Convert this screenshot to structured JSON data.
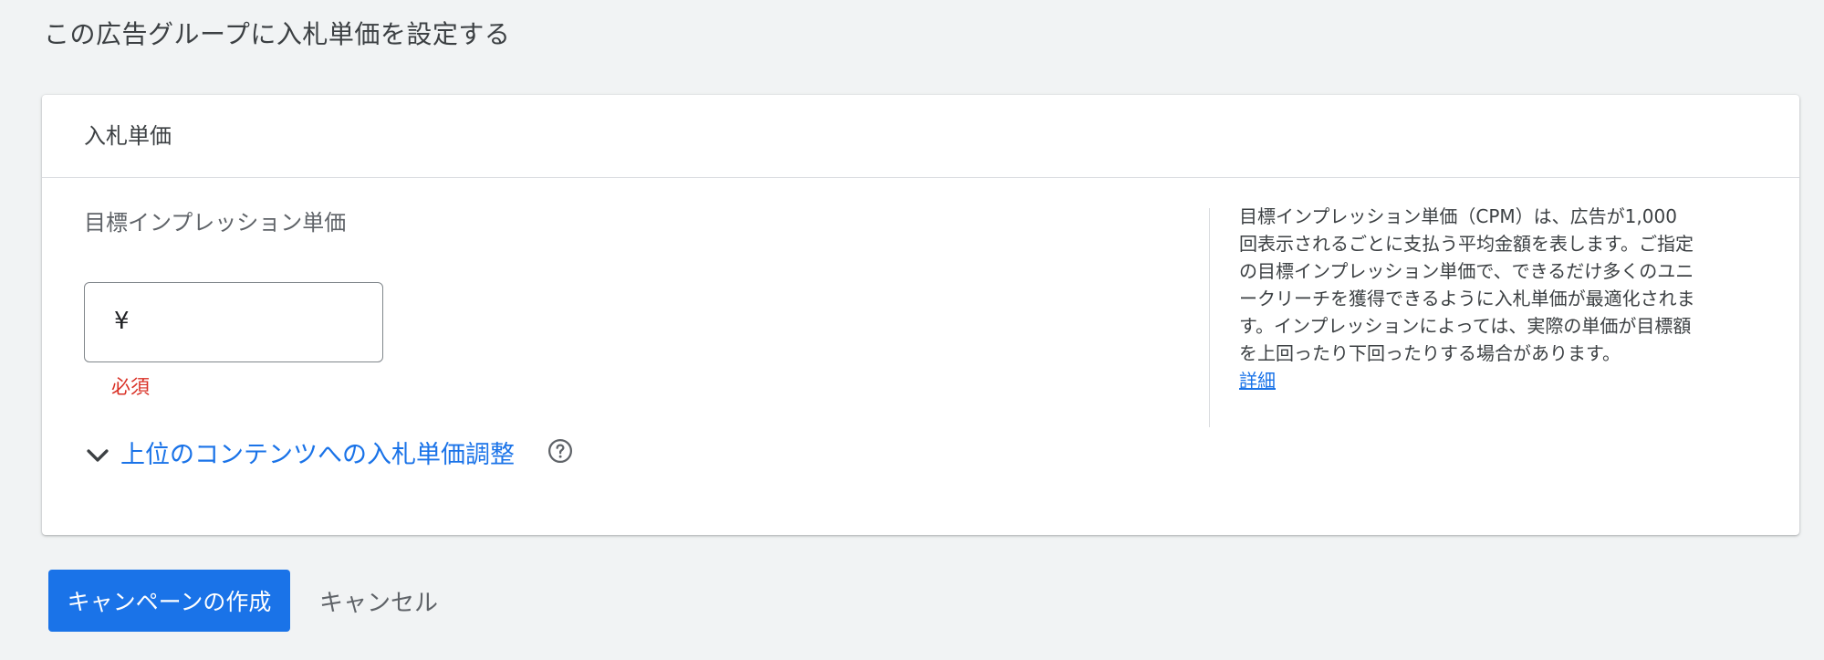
{
  "page": {
    "title": "この広告グループに入札単価を設定する"
  },
  "bid_section": {
    "header_title": "入札単価",
    "field_label": "目標インプレッション単価",
    "currency_symbol": "¥",
    "input_value": "",
    "required_text": "必須",
    "bid_adjust_label": "上位のコンテンツへの入札単価調整",
    "chevron_icon": "chevron-down-icon",
    "help_icon": "help-circle-icon"
  },
  "help_panel": {
    "text": "目標インプレッション単価（CPM）は、広告が1,000 回表示されるごとに支払う平均金額を表します。ご指定の目標インプレッション単価で、できるだけ多くのユニークリーチを獲得できるように入札単価が最適化されます。インプレッションによっては、実際の単価が目標額を上回ったり下回ったりする場合があります。",
    "link_label": "詳細"
  },
  "actions": {
    "create_label": "キャンペーンの作成",
    "cancel_label": "キャンセル"
  },
  "colors": {
    "accent": "#1a73e8",
    "error": "#d93025",
    "background": "#f1f3f4",
    "card": "#ffffff"
  }
}
